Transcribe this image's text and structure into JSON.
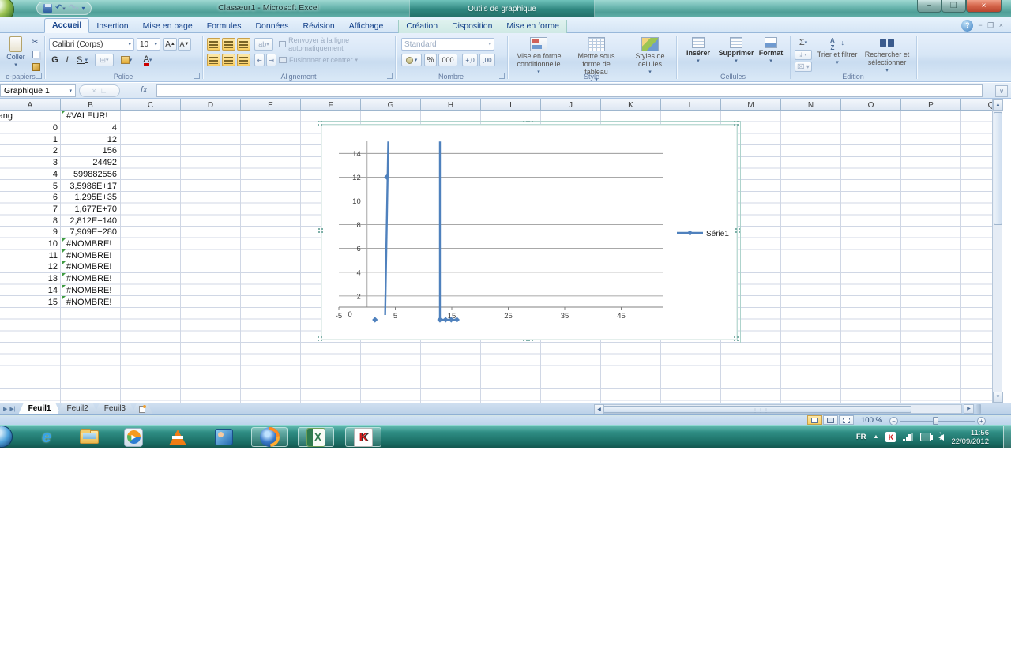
{
  "titlebar": {
    "title": "Classeur1 - Microsoft Excel",
    "contextual_title": "Outils de graphique",
    "window_buttons": {
      "minimize": "−",
      "restore": "❐",
      "close": "×"
    }
  },
  "tabs": {
    "main": [
      "Accueil",
      "Insertion",
      "Mise en page",
      "Formules",
      "Données",
      "Révision",
      "Affichage"
    ],
    "active": "Accueil",
    "contextual": [
      "Création",
      "Disposition",
      "Mise en forme"
    ]
  },
  "ribbon": {
    "clipboard": {
      "label": "e-papiers",
      "paste": "Coller"
    },
    "font": {
      "label": "Police",
      "font_name": "Calibri (Corps)",
      "font_size": "10",
      "bold": "G",
      "italic": "I",
      "underline": "S"
    },
    "alignment": {
      "label": "Alignement",
      "wrap": "Renvoyer à la ligne automatiquement",
      "merge": "Fusionner et centrer"
    },
    "number": {
      "label": "Nombre",
      "format": "Standard",
      "percent": "%",
      "thousands": "000",
      "dec_plus": "+,0",
      "dec_minus": ",00"
    },
    "style": {
      "label": "Style",
      "conditional": "Mise en forme conditionnelle",
      "as_table": "Mettre sous forme de tableau",
      "cell_styles": "Styles de cellules"
    },
    "cells": {
      "label": "Cellules",
      "insert": "Insérer",
      "delete": "Supprimer",
      "format": "Format"
    },
    "editing": {
      "label": "Édition",
      "sum": "Σ",
      "sort": "Trier et filtrer",
      "find": "Rechercher et sélectionner"
    }
  },
  "formula_bar": {
    "name_box": "Graphique 1",
    "fx": "fx"
  },
  "sheet": {
    "columns": [
      "A",
      "B",
      "C",
      "D",
      "E",
      "F",
      "G",
      "H",
      "I",
      "J",
      "K",
      "L",
      "M",
      "N",
      "O",
      "P",
      "Q"
    ],
    "rows": [
      {
        "a": "rang",
        "b": "#VALEUR!"
      },
      {
        "a": "0",
        "b": "4"
      },
      {
        "a": "1",
        "b": "12"
      },
      {
        "a": "2",
        "b": "156"
      },
      {
        "a": "3",
        "b": "24492"
      },
      {
        "a": "4",
        "b": "599882556"
      },
      {
        "a": "5",
        "b": "3,5986E+17"
      },
      {
        "a": "6",
        "b": "1,295E+35"
      },
      {
        "a": "7",
        "b": "1,677E+70"
      },
      {
        "a": "8",
        "b": "2,812E+140"
      },
      {
        "a": "9",
        "b": "7,909E+280"
      },
      {
        "a": "10",
        "b": "#NOMBRE!"
      },
      {
        "a": "11",
        "b": "#NOMBRE!"
      },
      {
        "a": "12",
        "b": "#NOMBRE!"
      },
      {
        "a": "13",
        "b": "#NOMBRE!"
      },
      {
        "a": "14",
        "b": "#NOMBRE!"
      },
      {
        "a": "15",
        "b": "#NOMBRE!"
      }
    ],
    "sheet_tabs": [
      "Feuil1",
      "Feuil2",
      "Feuil3"
    ],
    "active_sheet": "Feuil1"
  },
  "chart_data": {
    "type": "scatter",
    "title": "",
    "legend": [
      "Série1"
    ],
    "legend_position": "right",
    "series_color": "#4f81bd",
    "grid": true,
    "x_ticks": [
      -5,
      5,
      15,
      25,
      35,
      45
    ],
    "y_ticks": [
      0,
      2,
      4,
      6,
      8,
      10,
      12,
      14
    ],
    "x_range": [
      -5,
      52
    ],
    "y_range": [
      0,
      15
    ],
    "markers": [
      [
        1.4,
        0
      ],
      [
        3.5,
        12
      ],
      [
        12.9,
        0
      ],
      [
        13.9,
        0
      ],
      [
        14.9,
        0
      ],
      [
        15.9,
        0
      ]
    ],
    "lines": [
      [
        [
          3.2,
          0.4
        ],
        [
          3.75,
          15
        ]
      ],
      [
        [
          12.9,
          15
        ],
        [
          12.9,
          0
        ],
        [
          15.9,
          0
        ]
      ]
    ]
  },
  "status_bar": {
    "zoom_level": "100 %"
  },
  "taskbar": {
    "icons": [
      "start",
      "internet-explorer",
      "windows-explorer",
      "media-player",
      "vlc",
      "messenger",
      "firefox",
      "excel",
      "kaspersky"
    ],
    "tray": {
      "lang": "FR",
      "time": "11:56",
      "date": "22/09/2012"
    }
  }
}
